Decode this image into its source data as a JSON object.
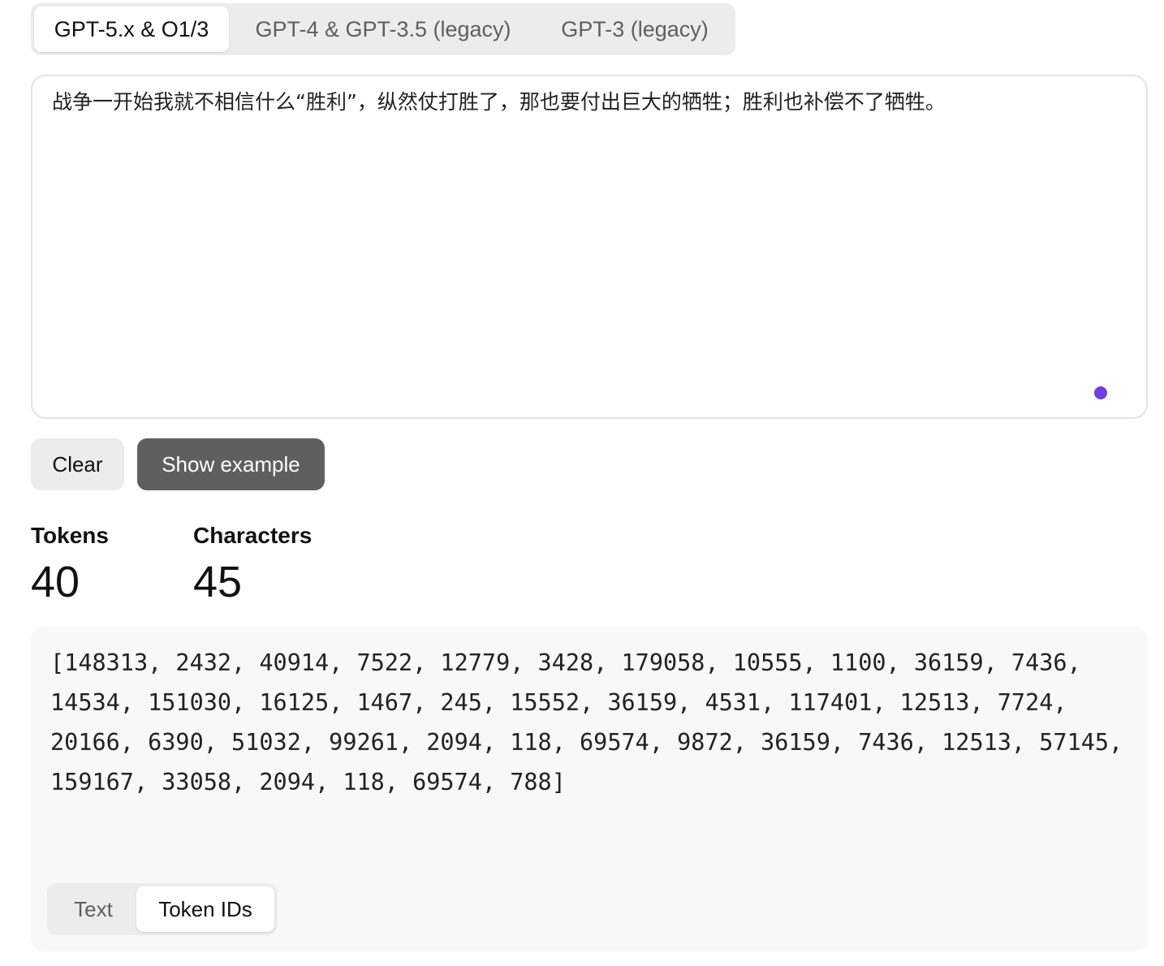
{
  "model_tabs": [
    {
      "label": "GPT-5.x & O1/3",
      "active": true
    },
    {
      "label": "GPT-4 & GPT-3.5 (legacy)",
      "active": false
    },
    {
      "label": "GPT-3 (legacy)",
      "active": false
    }
  ],
  "input": {
    "value": "战争一开始我就不相信什么“胜利”，纵然仗打胜了，那也要付出巨大的牺牲；胜利也补偿不了牺牲。"
  },
  "buttons": {
    "clear_label": "Clear",
    "example_label": "Show example"
  },
  "stats": {
    "tokens_label": "Tokens",
    "tokens_value": "40",
    "characters_label": "Characters",
    "characters_value": "45"
  },
  "output": {
    "token_ids": "[148313, 2432, 40914, 7522, 12779, 3428, 179058, 10555, 1100, 36159, 7436, 14534, 151030, 16125, 1467, 245, 15552, 36159, 4531, 117401, 12513, 7724, 20166, 6390, 51032, 99261, 2094, 118, 69574, 9872, 36159, 7436, 12513, 57145, 159167, 33058, 2094, 118, 69574, 788]"
  },
  "view_toggle": {
    "text_label": "Text",
    "ids_label": "Token IDs",
    "active": "Token IDs"
  },
  "colors": {
    "accent_dot": "#6c3ce5",
    "example_button_bg": "#5f5f5f",
    "segment_bg": "#ececec",
    "panel_bg": "#f8f8f8"
  }
}
